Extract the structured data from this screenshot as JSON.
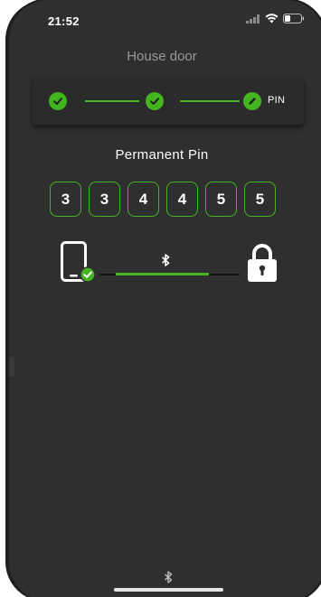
{
  "status_bar": {
    "time": "21:52",
    "icons": [
      "cellular-signal-icon",
      "wifi-icon",
      "battery-icon"
    ]
  },
  "header": {
    "title": "House door"
  },
  "stepper": {
    "steps": [
      {
        "icon": "check-icon",
        "state": "complete"
      },
      {
        "icon": "check-icon",
        "state": "complete"
      },
      {
        "icon": "pencil-icon",
        "state": "active",
        "label": "PIN"
      }
    ]
  },
  "pin": {
    "title": "Permanent Pin",
    "digits": [
      "3",
      "3",
      "4",
      "4",
      "5",
      "5"
    ]
  },
  "connection": {
    "icons": [
      "smartphone-icon",
      "verified-check-icon",
      "bluetooth-icon",
      "padlock-icon"
    ]
  },
  "footer": {
    "icon": "bluetooth-icon"
  },
  "colors": {
    "accent": "#43b51f",
    "background": "#2f2f2f",
    "card": "#2b2b2b",
    "text": "#ffffff",
    "muted_text": "#9a9a9a"
  }
}
